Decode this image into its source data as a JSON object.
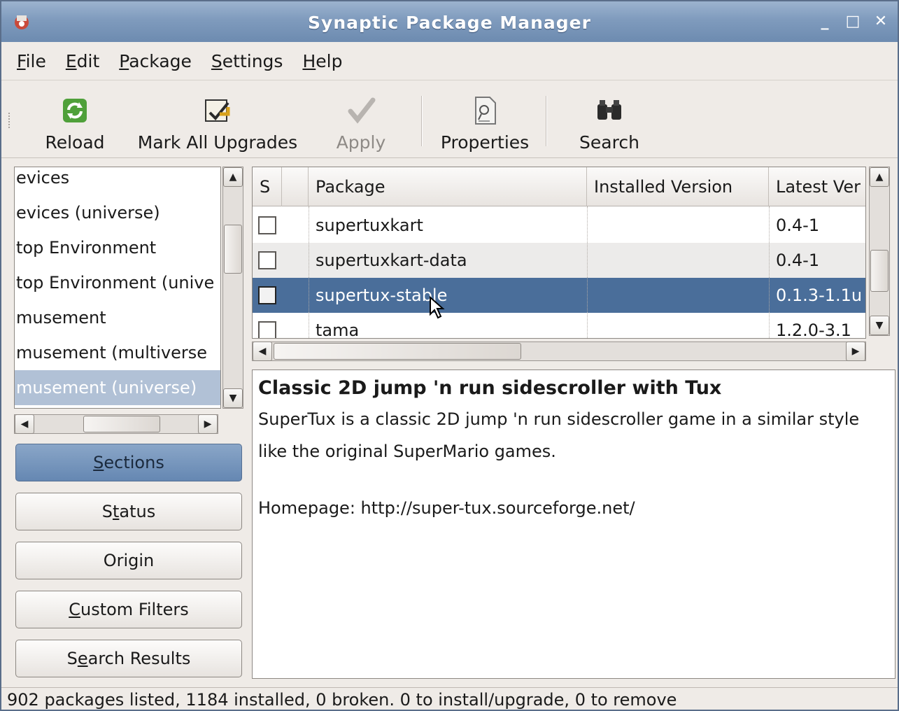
{
  "window": {
    "title": "Synaptic Package Manager",
    "minimize": "_",
    "maximize": "□",
    "close": "✕"
  },
  "menubar": {
    "items": [
      {
        "pre": "",
        "ul": "F",
        "post": "ile"
      },
      {
        "pre": "",
        "ul": "E",
        "post": "dit"
      },
      {
        "pre": "",
        "ul": "P",
        "post": "ackage"
      },
      {
        "pre": "",
        "ul": "S",
        "post": "ettings"
      },
      {
        "pre": "",
        "ul": "H",
        "post": "elp"
      }
    ]
  },
  "toolbar": {
    "reload": "Reload",
    "mark_all_upgrades": "Mark All Upgrades",
    "apply": "Apply",
    "properties": "Properties",
    "search": "Search"
  },
  "sections": {
    "items": [
      "evices",
      "evices (universe)",
      "top Environment",
      "top Environment (unive",
      "musement",
      "musement (multiverse",
      "musement (universe)"
    ],
    "selected_index": 6
  },
  "filters": {
    "sections": {
      "pre": "",
      "ul": "S",
      "post": "ections"
    },
    "status": {
      "pre": "S",
      "ul": "t",
      "post": "atus"
    },
    "origin": {
      "pre": "",
      "ul": "",
      "post": "Origin"
    },
    "custom_filters": {
      "pre": "",
      "ul": "C",
      "post": "ustom Filters"
    },
    "search_results": {
      "pre": "S",
      "ul": "e",
      "post": "arch Results"
    }
  },
  "table": {
    "columns": {
      "s": "S",
      "package": "Package",
      "installed": "Installed Version",
      "latest": "Latest Ver"
    },
    "rows": [
      {
        "package": "supertuxkart",
        "installed": "",
        "latest": "0.4-1"
      },
      {
        "package": "supertuxkart-data",
        "installed": "",
        "latest": "0.4-1"
      },
      {
        "package": "supertux-stable",
        "installed": "",
        "latest": "0.1.3-1.1u"
      },
      {
        "package": "tama",
        "installed": "",
        "latest": "1.2.0-3.1"
      }
    ],
    "selected_index": 2
  },
  "description": {
    "title": "Classic 2D jump 'n run sidescroller with Tux",
    "body": "SuperTux is a classic 2D jump 'n run sidescroller game in a similar style like the original SuperMario games.",
    "homepage": "Homepage: http://super-tux.sourceforge.net/"
  },
  "statusbar": {
    "text": "902 packages listed, 1184 installed, 0 broken. 0 to install/upgrade, 0 to remove"
  },
  "colors": {
    "titlebar": "#7f9bbd",
    "selection": "#4a6e9a",
    "active_filter": "#6587b2"
  },
  "icons": {
    "reload": "reload-icon",
    "mark_all_upgrades": "mark-upgrades-icon",
    "apply": "apply-checkmark-icon",
    "properties": "properties-icon",
    "search": "binoculars-icon"
  }
}
